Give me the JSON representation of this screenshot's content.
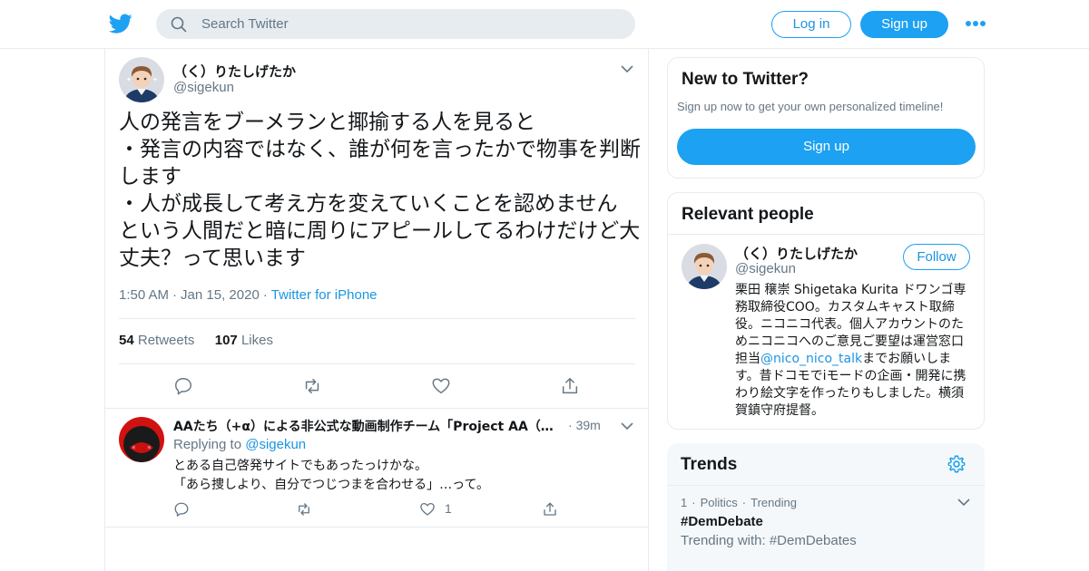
{
  "header": {
    "search_placeholder": "Search Twitter",
    "login_label": "Log in",
    "signup_label": "Sign up"
  },
  "tweet": {
    "author_name": "（く）りたしげたか",
    "author_handle": "@sigekun",
    "text": "人の発言をブーメランと揶揄する人を見ると\n・発言の内容ではなく、誰が何を言ったかで物事を判断します\n・人が成長して考え方を変えていくことを認めません\nという人間だと暗に周りにアピールしてるわけだけど大丈夫？って思います",
    "time": "1:50 AM",
    "date": "Jan 15, 2020",
    "source": "Twitter for iPhone",
    "retweets_count": "54",
    "retweets_label": "Retweets",
    "likes_count": "107",
    "likes_label": "Likes"
  },
  "reply": {
    "author_name": "AAたち（+α）による非公式な動画制作チーム「Project AA（…",
    "time": "39m",
    "replying_label": "Replying to",
    "replying_handle": "@sigekun",
    "text": "とある自己啓発サイトでもあったっけかな。\n「あら捜しより、自分でつじつまを合わせる」…って。",
    "like_count": "1"
  },
  "new_to_twitter": {
    "title": "New to Twitter?",
    "subtitle": "Sign up now to get your own personalized timeline!",
    "signup_label": "Sign up"
  },
  "relevant_people": {
    "title": "Relevant people",
    "name": "（く）りたしげたか",
    "handle": "@sigekun",
    "follow_label": "Follow",
    "bio_before": "栗田 穣崇 Shigetaka Kurita ドワンゴ専務取締役COO。カスタムキャスト取締役。ニコニコ代表。個人アカウントのためニコニコへのご意見ご要望は運営窓口担当",
    "bio_link": "@nico_nico_talk",
    "bio_after": "までお願いします。昔ドコモでiモードの企画・開発に携わり絵文字を作ったりもしました。横須賀鎮守府提督。"
  },
  "trends": {
    "title": "Trends",
    "items": [
      {
        "rank": "1",
        "category": "Politics",
        "status": "Trending",
        "hashtag": "#DemDebate",
        "trending_with": "Trending with: #DemDebates"
      }
    ]
  },
  "colors": {
    "accent": "#1da1f2",
    "link": "#1b95e0",
    "muted": "#657786",
    "border": "#e6ecf0"
  }
}
